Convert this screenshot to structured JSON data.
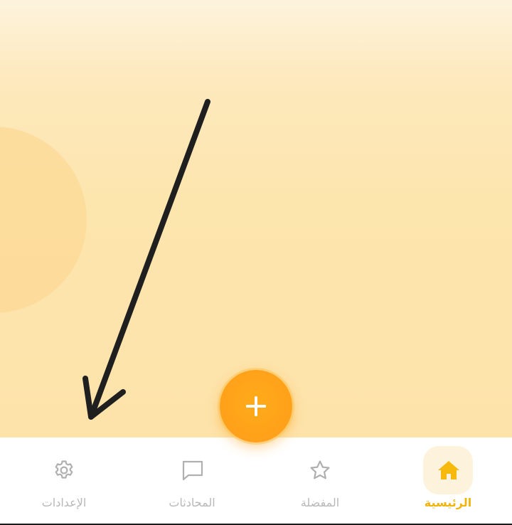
{
  "fab": {
    "label": "+",
    "icon": "plus-icon",
    "color": "#ffa51a"
  },
  "bottom_nav": {
    "active_color": "#f1b40a",
    "inactive_color": "#b8b8b8",
    "items": [
      {
        "label": "الإعدادات",
        "icon": "gear-icon",
        "active": false
      },
      {
        "label": "المحادثات",
        "icon": "chat-bubble-icon",
        "active": false
      },
      {
        "label": "المفضلة",
        "icon": "star-icon",
        "active": false
      },
      {
        "label": "الرئيسية",
        "icon": "home-icon",
        "active": true
      }
    ]
  },
  "annotation": {
    "icon": "arrow-icon",
    "color": "#1f1f1f"
  }
}
